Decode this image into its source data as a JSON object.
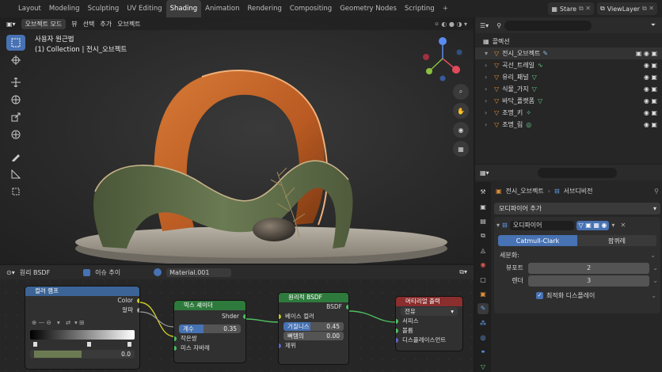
{
  "topbar": {
    "tabs": [
      "Layout",
      "Modeling",
      "Sculpting",
      "UV Editing",
      "Shading",
      "Animation",
      "Rendering",
      "Compositing",
      "Geometry Nodes",
      "Scripting"
    ],
    "active_tab": "Shading",
    "scene": "Stare",
    "view_layer": "ViewLayer"
  },
  "viewport": {
    "header": {
      "mode": "오브젝트 모드",
      "menus": [
        "뷰",
        "선택",
        "추가",
        "오브젝트"
      ]
    },
    "info_title": "사용자 원근법",
    "info_subtitle": "(1) Collection | 전시_오브젝트"
  },
  "node_editor": {
    "header": {
      "type": "원리 BSDF",
      "slot_checkbox": "이슈 추이",
      "material": "Material.001"
    },
    "nodes": {
      "color_ramp": {
        "title": "컬러 램프",
        "out_color": "Color",
        "out_alpha": "알파",
        "pos_value": "0.0"
      },
      "mix_shader": {
        "title": "믹스 셰이더",
        "out_shader": "Shder",
        "fac_label": "계수",
        "fac_value": "0.35",
        "in1": "작은쌍",
        "in2": "미스 자바레"
      },
      "bsdf": {
        "title": "원리적 BSDF",
        "out": "BSDF",
        "in_base": "베이스 컬러",
        "roughness_label": "거칠니스",
        "roughness_value": "0.45",
        "metallic_label": "뻐템의",
        "metallic_value": "0.00",
        "normal": "제위"
      },
      "output": {
        "title": "머티리얼 출력",
        "target": "전유",
        "in_surface": "서피스",
        "in_volume": "볼륨",
        "in_disp": "디스플레이스먼트"
      }
    }
  },
  "outliner": {
    "collection": "콜렉션",
    "items": [
      {
        "label": "전시_오브젝트",
        "mod": "wrench-icon"
      },
      {
        "label": "곡선_트레일",
        "mod": "curve-icon"
      },
      {
        "label": "유리_패널",
        "mod": "mesh-icon"
      },
      {
        "label": "식물_가지",
        "mod": "mesh-icon"
      },
      {
        "label": "바닥_플랫폼",
        "mod": "mesh-icon"
      },
      {
        "label": "조명_키",
        "mod": "light-icon"
      },
      {
        "label": "조명_림",
        "mod": "world-icon"
      }
    ]
  },
  "properties": {
    "breadcrumb_object": "전시_오브젝트",
    "breadcrumb_mod": "서브디비전",
    "add_modifier": "모디파이어 추가",
    "modifier_name": "오디파이어",
    "tab_catmull": "Catmull-Clark",
    "tab_simple": "팜퀴레",
    "subdiv_label": "세분화:",
    "viewport_label": "뷰포트",
    "viewport_value": "2",
    "render_label": "렌더",
    "render_value": "3",
    "optimal_display": "최적화 디스플레이"
  },
  "colors": {
    "accent": "#4772b3",
    "orange": "#c46424",
    "olive": "#5c6a48"
  }
}
